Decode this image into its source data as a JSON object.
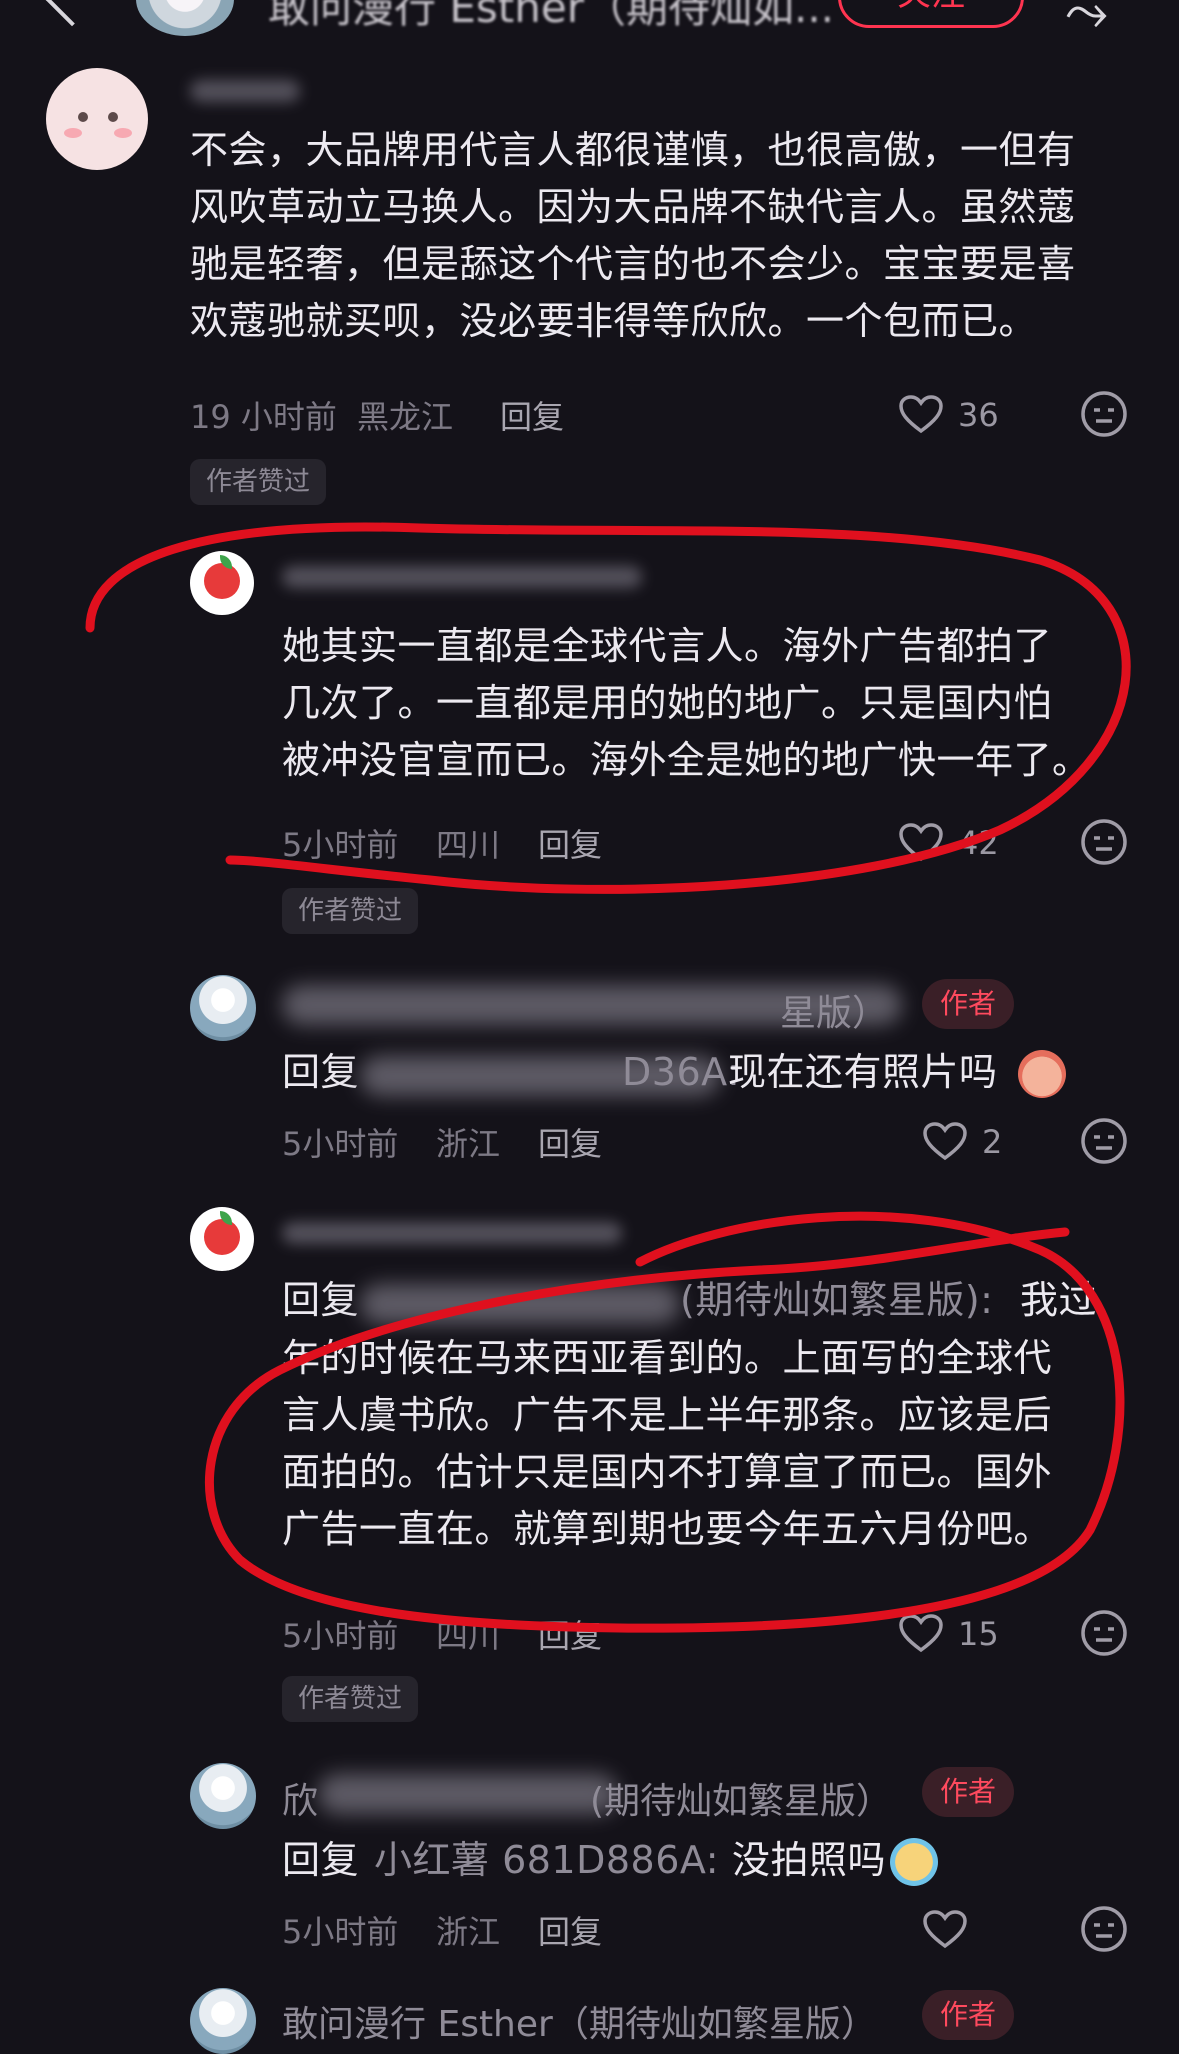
{
  "topbar": {
    "title": "敢问漫行 Esther（期待灿如...",
    "follow_label": "关注"
  },
  "comments": [
    {
      "body": "不会，大品牌用代言人都很谨慎，也很高傲，一但有\n风吹草动立马换人。因为大品牌不缺代言人。虽然蔻\n驰是轻奢，但是舔这个代言的也不会少。宝宝要是喜\n欢蔻驰就买呗，没必要非得等欣欣。一个包而已。",
      "time": "19 小时前",
      "location": "黑龙江",
      "reply": "回复",
      "likes": "36",
      "tag": "作者赞过"
    },
    {
      "body": "她其实一直都是全球代言人。海外广告都拍了\n几次了。一直都是用的她的地广。只是国内怕\n被冲没官宣而已。海外全是她的地广快一年了。",
      "time": "5小时前",
      "location": "四川",
      "reply": "回复",
      "likes": "42",
      "tag": "作者赞过"
    },
    {
      "name_suffix": "星版）",
      "author_badge": "作者",
      "reply_prefix": "回复",
      "reply_target_tail": "D36A:",
      "body": "现在还有照片吗",
      "time": "5小时前",
      "location": "浙江",
      "reply": "回复",
      "likes": "2"
    },
    {
      "reply_prefix": "回复",
      "name_tail": "(期待灿如繁星版):",
      "body_first": "我过",
      "body": "年的时候在马来西亚看到的。上面写的全球代\n言人虞书欣。广告不是上半年那条。应该是后\n面拍的。估计只是国内不打算宣了而已。国外\n广告一直在。就算到期也要今年五六月份吧。",
      "time": "5小时前",
      "location": "四川",
      "reply": "回复",
      "likes": "15",
      "tag": "作者赞过"
    },
    {
      "name_head": "欣",
      "name_suffix": "(期待灿如繁星版）",
      "author_badge": "作者",
      "reply_prefix": "回复",
      "reply_target": "小红薯 681D886A:",
      "body": "没拍照吗",
      "time": "5小时前",
      "location": "浙江",
      "reply": "回复"
    },
    {
      "name": "敢问漫行 Esther（期待灿如繁星版）",
      "author_badge": "作者"
    }
  ]
}
